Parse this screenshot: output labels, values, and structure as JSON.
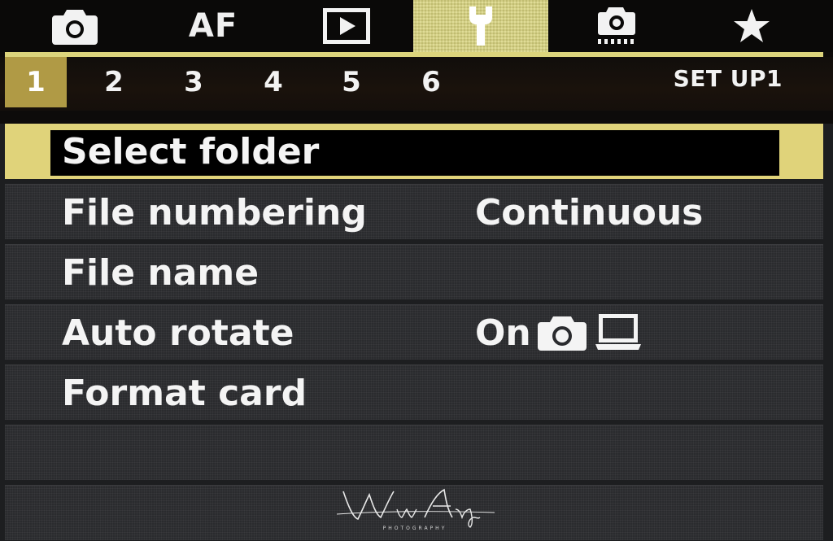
{
  "tabs": [
    {
      "name": "shooting",
      "icon": "camera-icon",
      "active": false
    },
    {
      "name": "af",
      "label": "AF",
      "active": false
    },
    {
      "name": "playback",
      "icon": "playback-icon",
      "active": false
    },
    {
      "name": "setup",
      "icon": "wrench-icon",
      "active": true
    },
    {
      "name": "custom-functions",
      "icon": "custom-camera-icon",
      "active": false
    },
    {
      "name": "my-menu",
      "icon": "star-icon",
      "active": false
    }
  ],
  "subtabs": [
    "1",
    "2",
    "3",
    "4",
    "5",
    "6"
  ],
  "active_subtab": "1",
  "page_label": "SET UP1",
  "menu": {
    "items": [
      {
        "label": "Select folder",
        "value": "",
        "selected": true
      },
      {
        "label": "File numbering",
        "value": "Continuous",
        "selected": false
      },
      {
        "label": "File name",
        "value": "",
        "selected": false
      },
      {
        "label": "Auto rotate",
        "value": "On",
        "value_icons": [
          "camera-icon",
          "computer-icon"
        ],
        "selected": false
      },
      {
        "label": "Format card",
        "value": "",
        "selected": false
      },
      {
        "label": "",
        "value": "",
        "selected": false
      },
      {
        "label": "",
        "value": "",
        "selected": false
      }
    ]
  },
  "watermark": {
    "name": "Wim Arys",
    "subtitle": "PHOTOGRAPHY"
  },
  "colors": {
    "tab_active": "#d9d47e",
    "subtab_active": "#b09a45",
    "highlight": "#e0d37a",
    "row_bg": "#2a2b2e",
    "text": "#f2f2f2"
  }
}
